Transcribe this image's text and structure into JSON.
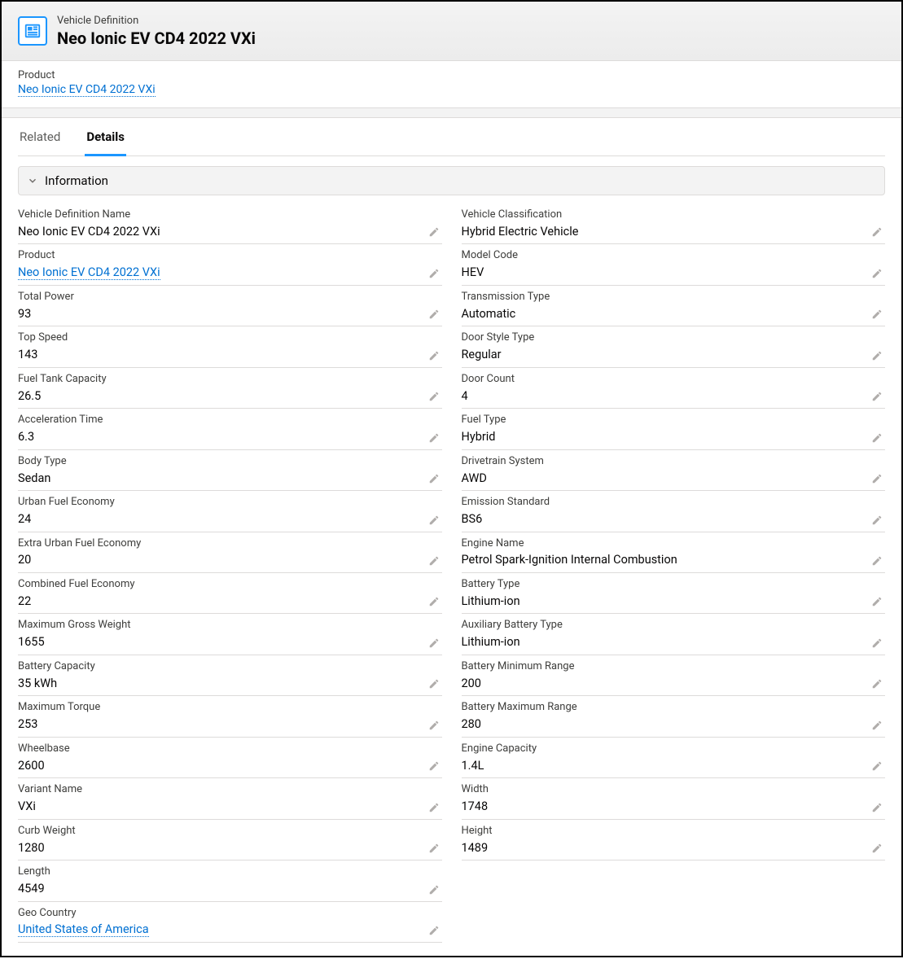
{
  "header": {
    "type_label": "Vehicle Definition",
    "title": "Neo Ionic EV CD4 2022 VXi"
  },
  "compact": {
    "product_label": "Product",
    "product_value": "Neo Ionic EV CD4 2022 VXi"
  },
  "tabs": {
    "related": "Related",
    "details": "Details"
  },
  "section": {
    "information": "Information"
  },
  "fields": {
    "left": [
      {
        "label": "Vehicle Definition Name",
        "value": "Neo Ionic EV CD4 2022 VXi",
        "editable": true
      },
      {
        "label": "Product",
        "value": "Neo Ionic EV CD4 2022 VXi",
        "editable": true,
        "link": true
      },
      {
        "label": "Total Power",
        "value": "93",
        "editable": true
      },
      {
        "label": "Top Speed",
        "value": "143",
        "editable": true
      },
      {
        "label": "Fuel Tank Capacity",
        "value": "26.5",
        "editable": true
      },
      {
        "label": "Acceleration Time",
        "value": "6.3",
        "editable": true
      },
      {
        "label": "Body Type",
        "value": "Sedan",
        "editable": true
      },
      {
        "label": "Urban Fuel Economy",
        "value": "24",
        "editable": true
      },
      {
        "label": "Extra Urban Fuel Economy",
        "value": "20",
        "editable": true
      },
      {
        "label": "Combined Fuel Economy",
        "value": "22",
        "editable": true
      },
      {
        "label": "Maximum Gross Weight",
        "value": "1655",
        "editable": true
      },
      {
        "label": "Battery Capacity",
        "value": "35 kWh",
        "editable": true
      },
      {
        "label": "Maximum Torque",
        "value": "253",
        "editable": true
      },
      {
        "label": "Wheelbase",
        "value": "2600",
        "editable": true
      },
      {
        "label": "Variant Name",
        "value": "VXi",
        "editable": true
      },
      {
        "label": "Curb Weight",
        "value": "1280",
        "editable": true
      },
      {
        "label": "Length",
        "value": "4549",
        "editable": true
      },
      {
        "label": "Geo Country",
        "value": "United States of America",
        "editable": true,
        "link": true
      }
    ],
    "right": [
      {
        "label": "Vehicle Classification",
        "value": "Hybrid Electric Vehicle",
        "editable": true
      },
      {
        "label": "Model Code",
        "value": "HEV",
        "editable": true
      },
      {
        "label": "Transmission Type",
        "value": "Automatic",
        "editable": true
      },
      {
        "label": "Door Style Type",
        "value": "Regular",
        "editable": true
      },
      {
        "label": "Door Count",
        "value": "4",
        "editable": true
      },
      {
        "label": "Fuel Type",
        "value": "Hybrid",
        "editable": true
      },
      {
        "label": "Drivetrain System",
        "value": "AWD",
        "editable": true
      },
      {
        "label": "Emission Standard",
        "value": "BS6",
        "editable": true
      },
      {
        "label": "Engine Name",
        "value": "Petrol Spark-Ignition Internal Combustion",
        "editable": true
      },
      {
        "label": "Battery Type",
        "value": "Lithium-ion",
        "editable": true
      },
      {
        "label": "Auxiliary Battery Type",
        "value": "Lithium-ion",
        "editable": true
      },
      {
        "label": "Battery Minimum Range",
        "value": "200",
        "editable": true
      },
      {
        "label": "Battery Maximum Range",
        "value": "280",
        "editable": true
      },
      {
        "label": "Engine Capacity",
        "value": "1.4L",
        "editable": true
      },
      {
        "label": "Width",
        "value": "1748",
        "editable": true
      },
      {
        "label": "Height",
        "value": "1489",
        "editable": true
      }
    ]
  }
}
